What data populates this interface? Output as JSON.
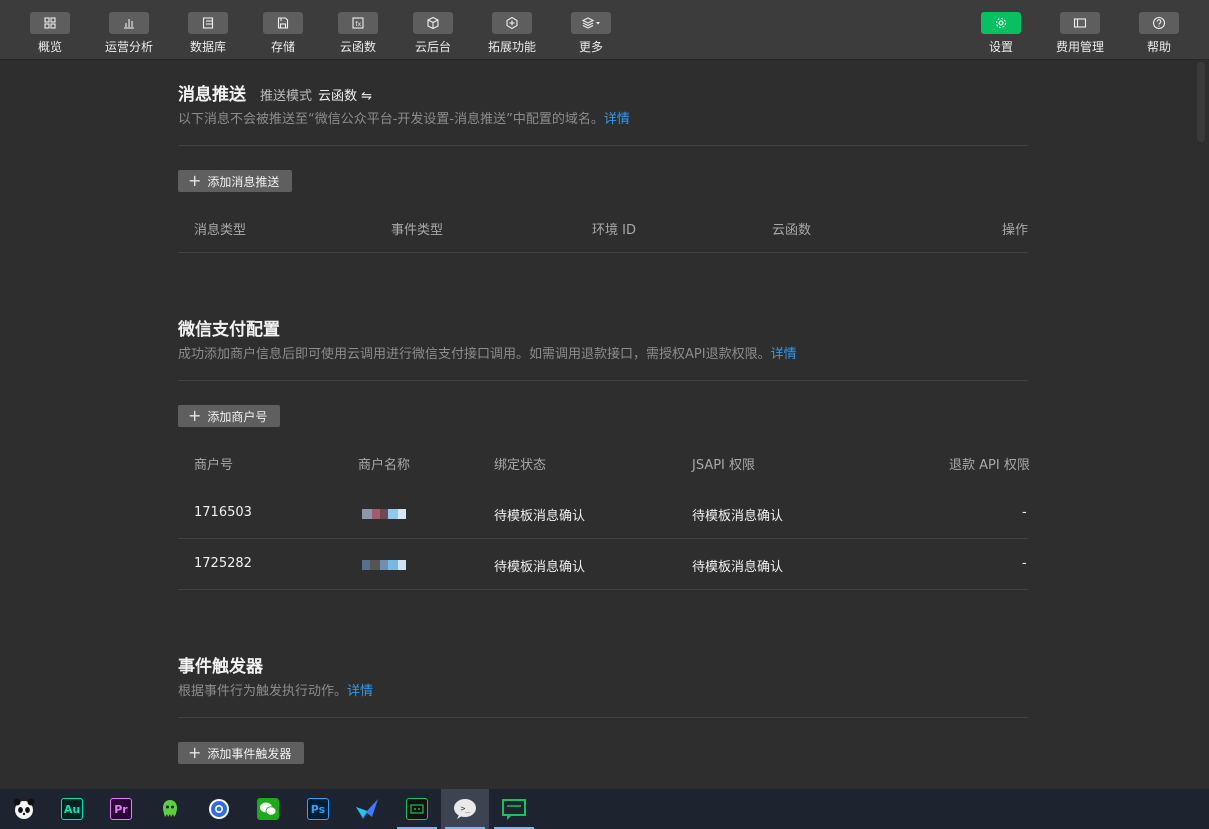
{
  "toolbar": {
    "left_items": [
      {
        "label": "概览",
        "icon": "overview-grid-icon"
      },
      {
        "label": "运营分析",
        "icon": "bar-chart-icon"
      },
      {
        "label": "数据库",
        "icon": "database-icon"
      },
      {
        "label": "存储",
        "icon": "storage-icon"
      },
      {
        "label": "云函数",
        "icon": "cloud-function-icon"
      },
      {
        "label": "云后台",
        "icon": "cube-icon"
      },
      {
        "label": "拓展功能",
        "icon": "extension-icon"
      },
      {
        "label": "更多",
        "icon": "layers-icon"
      }
    ],
    "right_items": [
      {
        "label": "设置",
        "icon": "gear-icon",
        "active": true
      },
      {
        "label": "费用管理",
        "icon": "billing-icon"
      },
      {
        "label": "帮助",
        "icon": "help-icon"
      }
    ],
    "active_color": "#07c160"
  },
  "message_push": {
    "title": "消息推送",
    "mode_label": "推送模式",
    "mode_value": "云函数 ⇋",
    "desc": "以下消息不会被推送至“微信公众平台-开发设置-消息推送”中配置的域名。",
    "link": "详情",
    "add_button": "添加消息推送",
    "columns": [
      "消息类型",
      "事件类型",
      "环境 ID",
      "云函数",
      "操作"
    ]
  },
  "wechat_pay": {
    "title": "微信支付配置",
    "desc": "成功添加商户信息后即可使用云调用进行微信支付接口调用。如需调用退款接口，需授权API退款权限。",
    "link": "详情",
    "add_button": "添加商户号",
    "columns": [
      "商户号",
      "商户名称",
      "绑定状态",
      "JSAPI 权限",
      "退款 API 权限"
    ],
    "rows": [
      {
        "merchant_id": "1716503",
        "bind_status": "待模板消息确认",
        "jsapi": "待模板消息确认",
        "refund": "-"
      },
      {
        "merchant_id": "1725282",
        "bind_status": "待模板消息确认",
        "jsapi": "待模板消息确认",
        "refund": "-"
      }
    ]
  },
  "event_trigger": {
    "title": "事件触发器",
    "desc": "根据事件行为触发执行动作。",
    "link": "详情",
    "add_button": "添加事件触发器"
  },
  "taskbar": {
    "apps": [
      {
        "name": "panda-app-icon"
      },
      {
        "name": "audition-icon",
        "text": "Au"
      },
      {
        "name": "premiere-icon",
        "text": "Pr"
      },
      {
        "name": "octopus-app-icon"
      },
      {
        "name": "browser-icon"
      },
      {
        "name": "wechat-icon"
      },
      {
        "name": "photoshop-icon",
        "text": "Ps"
      },
      {
        "name": "feishu-icon"
      },
      {
        "name": "devtools-icon"
      },
      {
        "name": "wechat-devtools-icon"
      },
      {
        "name": "chat-app-icon"
      }
    ]
  }
}
